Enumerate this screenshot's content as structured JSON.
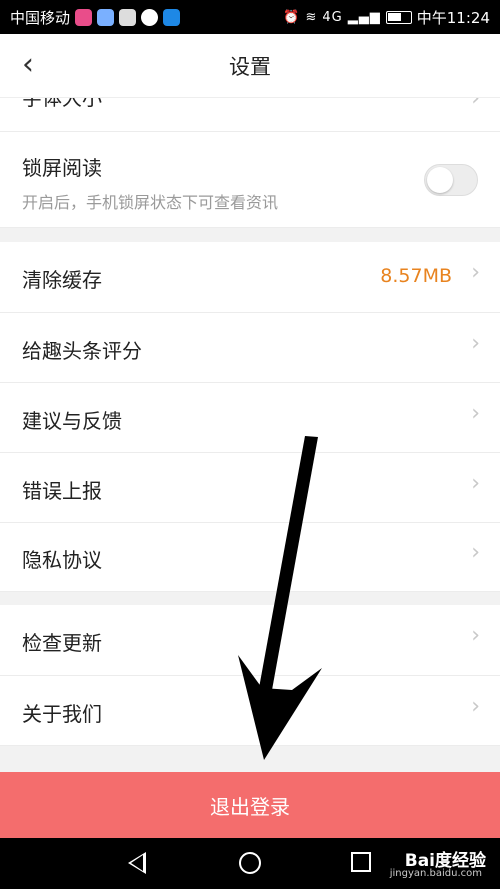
{
  "status_bar": {
    "carrier": "中国移动",
    "time": "中午11:24",
    "network": "4G"
  },
  "header": {
    "title": "设置",
    "back_glyph": "‹"
  },
  "rows": {
    "font_size": {
      "label": "字体大小"
    },
    "lock_screen": {
      "label": "锁屏阅读",
      "description": "开启后，手机锁屏状态下可查看资讯",
      "enabled": false
    },
    "clear_cache": {
      "label": "清除缓存",
      "value": "8.57MB"
    },
    "rate": {
      "label": "给趣头条评分"
    },
    "feedback": {
      "label": "建议与反馈"
    },
    "report": {
      "label": "错误上报"
    },
    "privacy": {
      "label": "隐私协议"
    },
    "update": {
      "label": "检查更新"
    },
    "about": {
      "label": "关于我们"
    }
  },
  "logout": {
    "label": "退出登录"
  },
  "watermark": {
    "brand": "Bai度经验",
    "url": "jingyan.baidu.com"
  },
  "colors": {
    "accent": "#f46d6d",
    "value": "#e8831f"
  }
}
